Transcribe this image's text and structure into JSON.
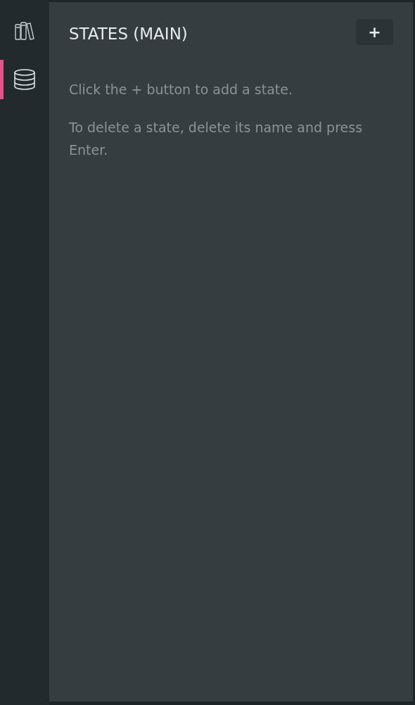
{
  "sidebar": {
    "items": [
      {
        "kind": "books",
        "selected": false
      },
      {
        "kind": "database",
        "selected": true
      }
    ]
  },
  "panel": {
    "title": "STATES (MAIN)",
    "add_button": "+",
    "hints": [
      "Click the + button to add a state.",
      "To delete a state, delete its name and press Enter."
    ]
  }
}
